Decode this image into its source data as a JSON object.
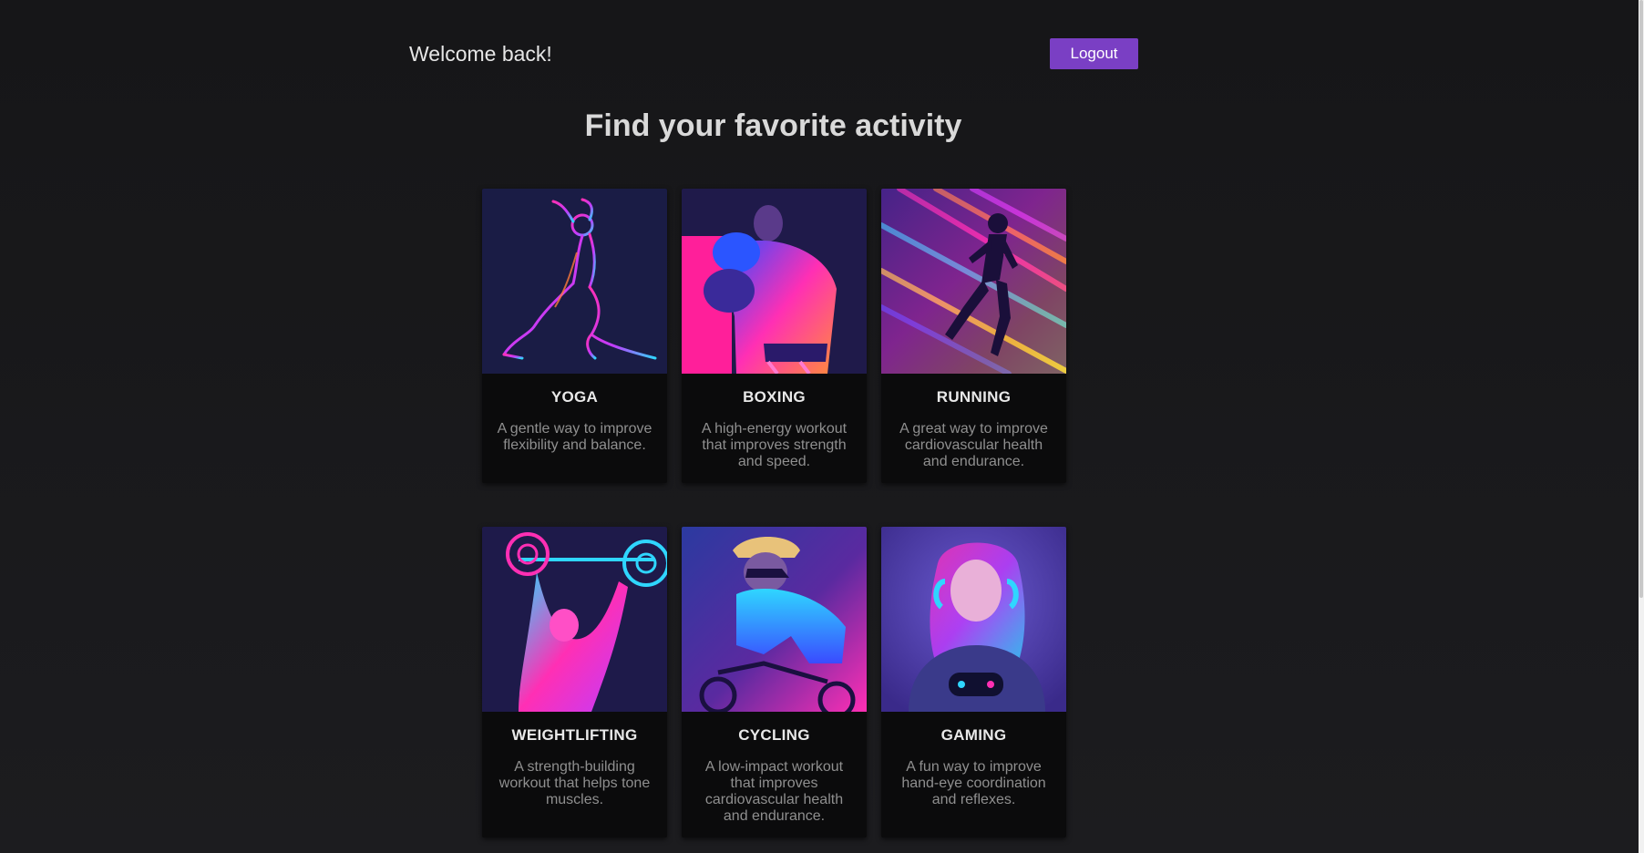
{
  "header": {
    "welcome": "Welcome back!",
    "logout_label": "Logout"
  },
  "main": {
    "title": "Find your favorite activity"
  },
  "activities": [
    {
      "title": "YOGA",
      "description": "A gentle way to improve flexibility and balance.",
      "image_icon": "yoga-pose-icon"
    },
    {
      "title": "BOXING",
      "description": "A high-energy workout that improves strength and speed.",
      "image_icon": "boxer-icon"
    },
    {
      "title": "RUNNING",
      "description": "A great way to improve cardiovascular health and endurance.",
      "image_icon": "runner-icon"
    },
    {
      "title": "WEIGHTLIFTING",
      "description": "A strength-building workout that helps tone muscles.",
      "image_icon": "weightlifter-icon"
    },
    {
      "title": "CYCLING",
      "description": "A low-impact workout that improves cardiovascular health and endurance.",
      "image_icon": "cyclist-icon"
    },
    {
      "title": "GAMING",
      "description": "A fun way to improve hand-eye coordination and reflexes.",
      "image_icon": "gamer-icon"
    }
  ],
  "colors": {
    "background": "#151517",
    "card": "#0b0b0c",
    "accent": "#7a3fc4",
    "neon_pink": "#ff2fb4",
    "neon_cyan": "#2fd6ff",
    "neon_blue": "#3a4bff",
    "navy": "#1a1c45"
  }
}
